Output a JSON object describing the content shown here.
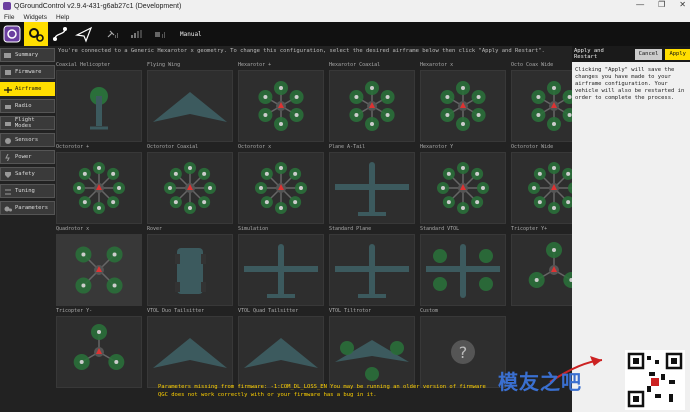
{
  "window": {
    "title": "QGroundControl v2.9.4-431-g6ab27c1 (Development)",
    "minimize": "—",
    "maximize": "❐",
    "close": "✕"
  },
  "menu": {
    "items": [
      "File",
      "Widgets",
      "Help"
    ]
  },
  "toolbar": {
    "mode": "Manual"
  },
  "sidebar": {
    "items": [
      {
        "label": "Summary",
        "active": false
      },
      {
        "label": "Firmware",
        "active": false
      },
      {
        "label": "Airframe",
        "active": true
      },
      {
        "label": "Radio",
        "active": false
      },
      {
        "label": "Flight Modes",
        "active": false
      },
      {
        "label": "Sensors",
        "active": false
      },
      {
        "label": "Power",
        "active": false
      },
      {
        "label": "Safety",
        "active": false
      },
      {
        "label": "Tuning",
        "active": false
      },
      {
        "label": "Parameters",
        "active": false
      }
    ]
  },
  "main": {
    "instruction": "You're connected to a Generic Hexarotor x geometry. To change this configuration, select the desired airframe below then click \"Apply and Restart\".",
    "tiles": [
      {
        "label": "Coaxial Helicopter",
        "kind": "coax"
      },
      {
        "label": "Flying Wing",
        "kind": "wing"
      },
      {
        "label": "Hexarotor +",
        "kind": "hex"
      },
      {
        "label": "Hexarotor Coaxial",
        "kind": "hex"
      },
      {
        "label": "Hexarotor x",
        "kind": "hex"
      },
      {
        "label": "Octo Coax Wide",
        "kind": "hex"
      },
      {
        "label": "Octorotor +",
        "kind": "octo"
      },
      {
        "label": "Octorotor Coaxial",
        "kind": "octo"
      },
      {
        "label": "Octorotor x",
        "kind": "octo"
      },
      {
        "label": "Plane A-Tail",
        "kind": "plane"
      },
      {
        "label": "Hexarotor Y",
        "kind": "octo"
      },
      {
        "label": "Octorotor Wide",
        "kind": "octo"
      },
      {
        "label": "Quadrotor x",
        "kind": "quadx",
        "selected": true
      },
      {
        "label": "Rover",
        "kind": "rover"
      },
      {
        "label": "Simulation",
        "kind": "plane2"
      },
      {
        "label": "Standard Plane",
        "kind": "plane2"
      },
      {
        "label": "Standard VTOL",
        "kind": "vtol"
      },
      {
        "label": "Tricopter Y+",
        "kind": "tri"
      },
      {
        "label": "Tricopter Y-",
        "kind": "tri"
      },
      {
        "label": "VTOL Duo Tailsitter",
        "kind": "wing"
      },
      {
        "label": "VTOL Quad Tailsitter",
        "kind": "wing"
      },
      {
        "label": "VTOL Tiltrotor",
        "kind": "tilt"
      },
      {
        "label": "Custom",
        "kind": "unknown"
      }
    ]
  },
  "right_panel": {
    "header": "Apply and Restart",
    "cancel": "Cancel",
    "apply": "Apply",
    "body": "Clicking \"Apply\" will save the changes you have made to your airframe configuration. Your vehicle will also be restarted in order to complete the process."
  },
  "warning": "Parameters missing from firmware: -1:COM_DL_LOSS_EN  You may be running an older version of firmware QGC does not work correctly with or your firmware has a bug in it.",
  "watermark": {
    "text": "模友之吧"
  },
  "colors": {
    "accent": "#ffde00",
    "rotor": "#2a6f3a",
    "body": "#3c5a5e"
  }
}
